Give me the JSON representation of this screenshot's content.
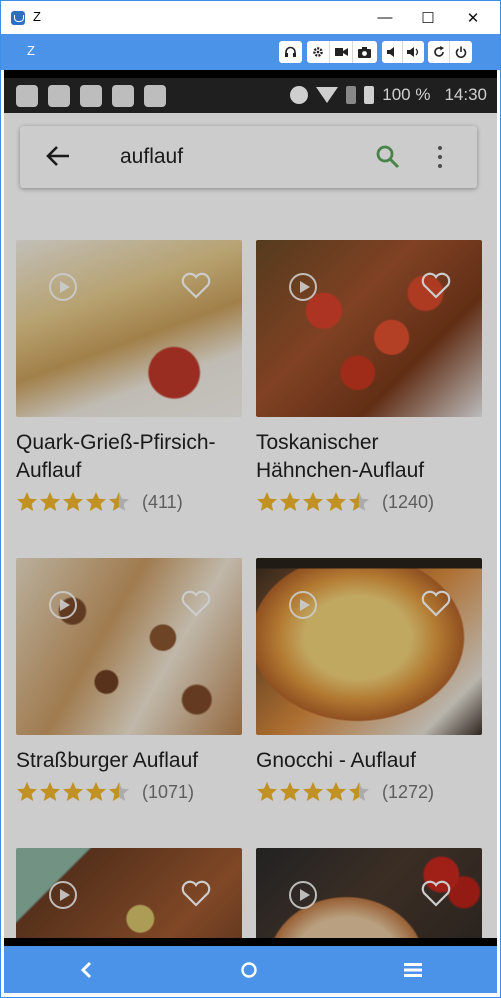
{
  "window": {
    "title": "Z",
    "minimize": "—",
    "maximize": "☐",
    "close": "✕"
  },
  "toolbar": {
    "title": "Z"
  },
  "statusbar": {
    "battery": "100 %",
    "time": "14:30"
  },
  "search": {
    "query": "auflauf"
  },
  "colors": {
    "accent": "#4a93e8",
    "search_icon": "#58a65c",
    "star": "#f2b62c",
    "star_empty": "#d6d6d6"
  },
  "recipes": [
    {
      "name": "Quark-Grieß-Pfirsich-Auflauf",
      "rating": 4.5,
      "count": "(411)",
      "image": "dessert-photo"
    },
    {
      "name": "Toskanischer Hähnchen-Auflauf",
      "rating": 4.5,
      "count": "(1240)",
      "image": "tomato-chicken-photo"
    },
    {
      "name": "Straßburger Auflauf",
      "rating": 4.5,
      "count": "(1071)",
      "image": "cheese-bake-photo"
    },
    {
      "name": "Gnocchi - Auflauf",
      "rating": 4.5,
      "count": "(1272)",
      "image": "gnocchi-photo"
    },
    {
      "name": "",
      "rating": 0,
      "count": "",
      "image": "veggie-bake-photo"
    },
    {
      "name": "",
      "rating": 0,
      "count": "",
      "image": "casserole-tomato-photo"
    }
  ]
}
